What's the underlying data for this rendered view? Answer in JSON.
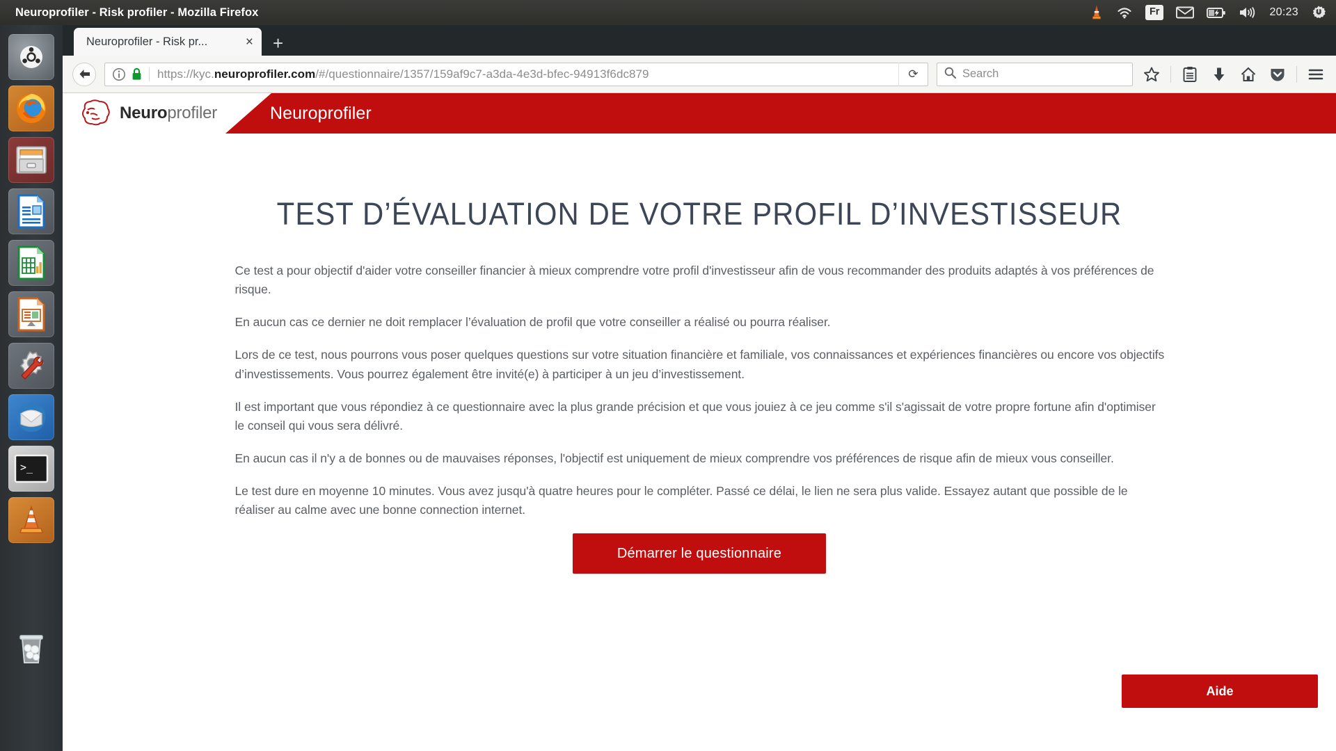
{
  "desktop": {
    "window_title": "Neuroprofiler - Risk profiler - Mozilla Firefox",
    "tray": {
      "keyboard_layout": "Fr",
      "clock": "20:23",
      "icons": [
        "vlc-tray-icon",
        "wifi-icon",
        "mail-icon",
        "battery-icon",
        "volume-icon",
        "power-gear-icon"
      ]
    },
    "launcher": [
      {
        "name": "ubuntu-dash",
        "label": "Ubuntu Dash"
      },
      {
        "name": "firefox",
        "label": "Firefox"
      },
      {
        "name": "files",
        "label": "Files"
      },
      {
        "name": "libreoffice-writer",
        "label": "LibreOffice Writer"
      },
      {
        "name": "libreoffice-calc",
        "label": "LibreOffice Calc"
      },
      {
        "name": "libreoffice-impress",
        "label": "LibreOffice Impress"
      },
      {
        "name": "system-settings",
        "label": "Software & Updates"
      },
      {
        "name": "thunderbird",
        "label": "Thunderbird Mail"
      },
      {
        "name": "terminal",
        "label": "Terminal"
      },
      {
        "name": "vlc",
        "label": "VLC Media Player"
      },
      {
        "name": "trash",
        "label": "Trash"
      }
    ]
  },
  "browser": {
    "tab": {
      "title": "Neuroprofiler - Risk pr...",
      "close_label": "×"
    },
    "new_tab_label": "+",
    "back_label": "←",
    "url": {
      "scheme": "https://kyc.",
      "domain": "neuroprofiler.com",
      "path": "/#/questionnaire/1357/159af9c7-a3da-4e3d-bfec-94913f6dc879",
      "full": "https://kyc.neuroprofiler.com/#/questionnaire/1357/159af9c7-a3da-4e3d-bfec-94913f6dc879"
    },
    "reload_label": "⟳",
    "search": {
      "placeholder": "Search",
      "value": ""
    },
    "toolbar_icons": [
      "bookmark-star-icon",
      "reader-list-icon",
      "downloads-icon",
      "home-icon",
      "pocket-icon",
      "menu-hamburger-icon"
    ]
  },
  "site": {
    "logo_bold": "Neuro",
    "logo_light": "profiler",
    "brand": "Neuroprofiler",
    "accent_color": "#c00d0d"
  },
  "main": {
    "title": "TEST D’ÉVALUATION DE VOTRE PROFIL D’INVESTISSEUR",
    "paragraphs": [
      "Ce test a pour objectif d'aider votre conseiller financier à mieux comprendre votre profil d'investisseur afin de vous recommander des produits adaptés à vos préférences de risque.",
      "En aucun cas ce dernier ne doit remplacer l’évaluation de profil que votre conseiller a réalisé ou pourra réaliser.",
      "Lors de ce test, nous pourrons vous poser quelques questions sur votre situation financière et familiale, vos connaissances et expériences financières ou encore vos objectifs d’investissements. Vous pourrez également être invité(e) à participer à un jeu d’investissement.",
      "Il est important que vous répondiez à ce questionnaire avec la plus grande précision et que vous jouiez à ce jeu comme s'il s'agissait de votre propre fortune afin d'optimiser le conseil qui vous sera délivré.",
      "En aucun cas il n'y a de bonnes ou de mauvaises réponses, l'objectif est uniquement de mieux comprendre vos préférences de risque afin de mieux vous conseiller.",
      "Le test dure en moyenne 10 minutes. Vous avez jusqu'à quatre heures pour le compléter. Passé ce délai, le lien ne sera plus valide. Essayez autant que possible de le réaliser au calme avec une bonne connection internet."
    ],
    "start_button": "Démarrer le questionnaire",
    "help_button": "Aide"
  }
}
